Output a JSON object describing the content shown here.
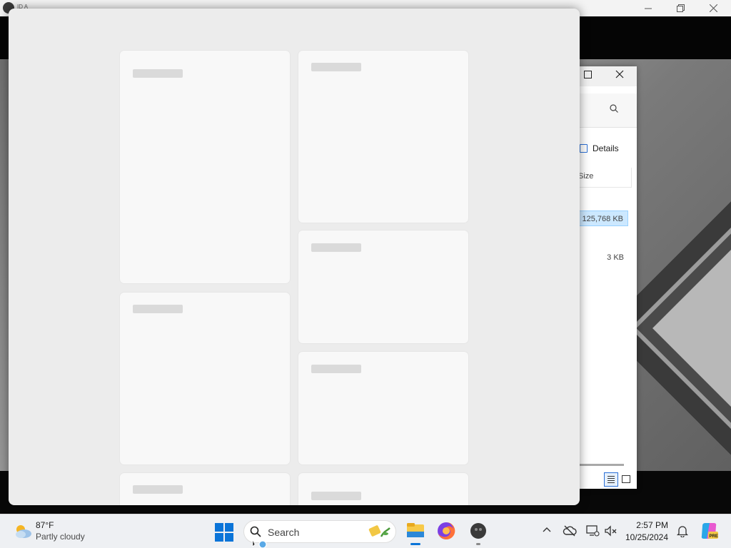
{
  "background_app": {
    "title": "ID A",
    "controls": [
      "minimize",
      "restore",
      "close"
    ]
  },
  "explorer": {
    "details_label": "Details",
    "column_size": "Size",
    "rows": [
      {
        "size": "125,768 KB",
        "selected": true
      },
      {
        "size": "3 KB",
        "selected": false
      }
    ]
  },
  "loading_window": {
    "state": "loading skeleton",
    "cards_count": 8
  },
  "taskbar": {
    "weather": {
      "temp": "87°F",
      "desc": "Partly cloudy",
      "icon": "partly-cloudy-icon"
    },
    "search": {
      "placeholder": "Search"
    },
    "apps": [
      "file-explorer",
      "firefox",
      "app"
    ],
    "clock": {
      "time": "2:57 PM",
      "date": "10/25/2024"
    },
    "tray_icons": [
      "chevron-up-icon",
      "onedrive-cloud-icon",
      "network-icon",
      "volume-muted-icon",
      "bell-icon",
      "copilot-icon"
    ]
  },
  "colors": {
    "accent": "#0a74d8",
    "window_bg": "#ececec",
    "card_bg": "#f8f8f8",
    "skeleton_bar": "#dadada",
    "taskbar_bg": "#eef0f3"
  }
}
